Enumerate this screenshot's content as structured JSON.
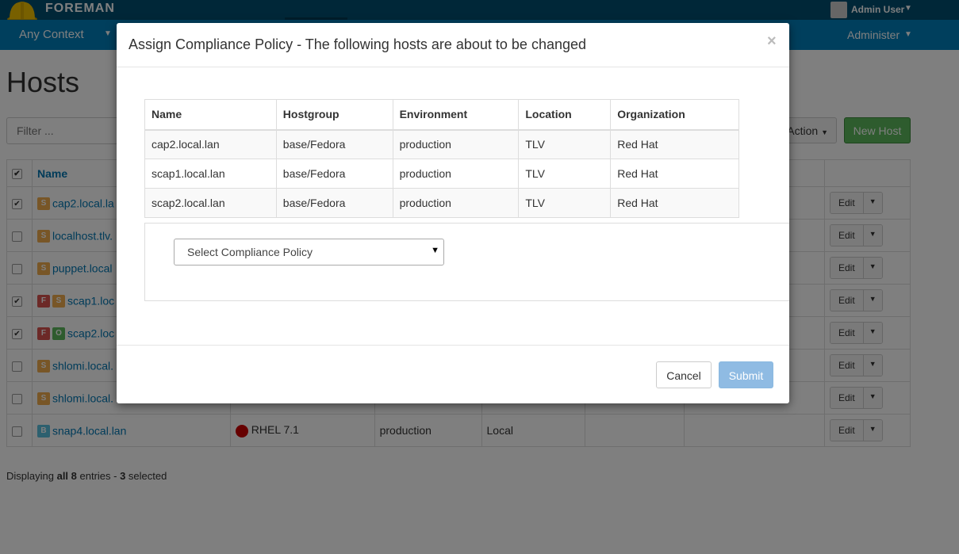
{
  "brand": {
    "name": "FOREMAN"
  },
  "user": {
    "name": "Admin User"
  },
  "nav": {
    "context": "Any Context",
    "administer": "Administer"
  },
  "page": {
    "title": "Hosts",
    "filter_placeholder": "Filter ...",
    "action_label": "Action",
    "new_host_label": "New Host",
    "column_name": "Name",
    "edit_label": "Edit"
  },
  "hosts": [
    {
      "checked": true,
      "badges": [
        "S"
      ],
      "name": "cap2.local.la"
    },
    {
      "checked": false,
      "badges": [
        "S"
      ],
      "name": "localhost.tlv."
    },
    {
      "checked": false,
      "badges": [
        "S"
      ],
      "name": "puppet.local"
    },
    {
      "checked": true,
      "badges": [
        "F",
        "S"
      ],
      "name": "scap1.loc"
    },
    {
      "checked": true,
      "badges": [
        "F",
        "O"
      ],
      "name": "scap2.loc"
    },
    {
      "checked": false,
      "badges": [
        "S"
      ],
      "name": "shlomi.local."
    },
    {
      "checked": false,
      "badges": [
        "S"
      ],
      "name": "shlomi.local."
    },
    {
      "checked": false,
      "badges": [
        "B"
      ],
      "name": "snap4.local.lan",
      "os": "RHEL 7.1",
      "environment": "production",
      "location": "Local"
    }
  ],
  "display": {
    "prefix": "Displaying ",
    "all": "all 8",
    "middle": " entries - ",
    "count": "3",
    "suffix": " selected"
  },
  "modal": {
    "title": "Assign Compliance Policy - The following hosts are about to be changed",
    "close": "×",
    "columns": [
      "Name",
      "Hostgroup",
      "Environment",
      "Location",
      "Organization"
    ],
    "rows": [
      [
        "cap2.local.lan",
        "base/Fedora",
        "production",
        "TLV",
        "Red Hat"
      ],
      [
        "scap1.local.lan",
        "base/Fedora",
        "production",
        "TLV",
        "Red Hat"
      ],
      [
        "scap2.local.lan",
        "base/Fedora",
        "production",
        "TLV",
        "Red Hat"
      ]
    ],
    "select_placeholder": "Select Compliance Policy",
    "cancel": "Cancel",
    "submit": "Submit"
  },
  "colors": {
    "brand_bar": "#004e71",
    "nav_bar": "#007fbb",
    "new_host": "#5cb85c",
    "submit": "#8fbbe3"
  },
  "icons": {
    "logo": "foreman-helmet-icon",
    "user": "user-avatar-icon",
    "caret": "caret-down-icon",
    "os": "redhat-icon"
  }
}
